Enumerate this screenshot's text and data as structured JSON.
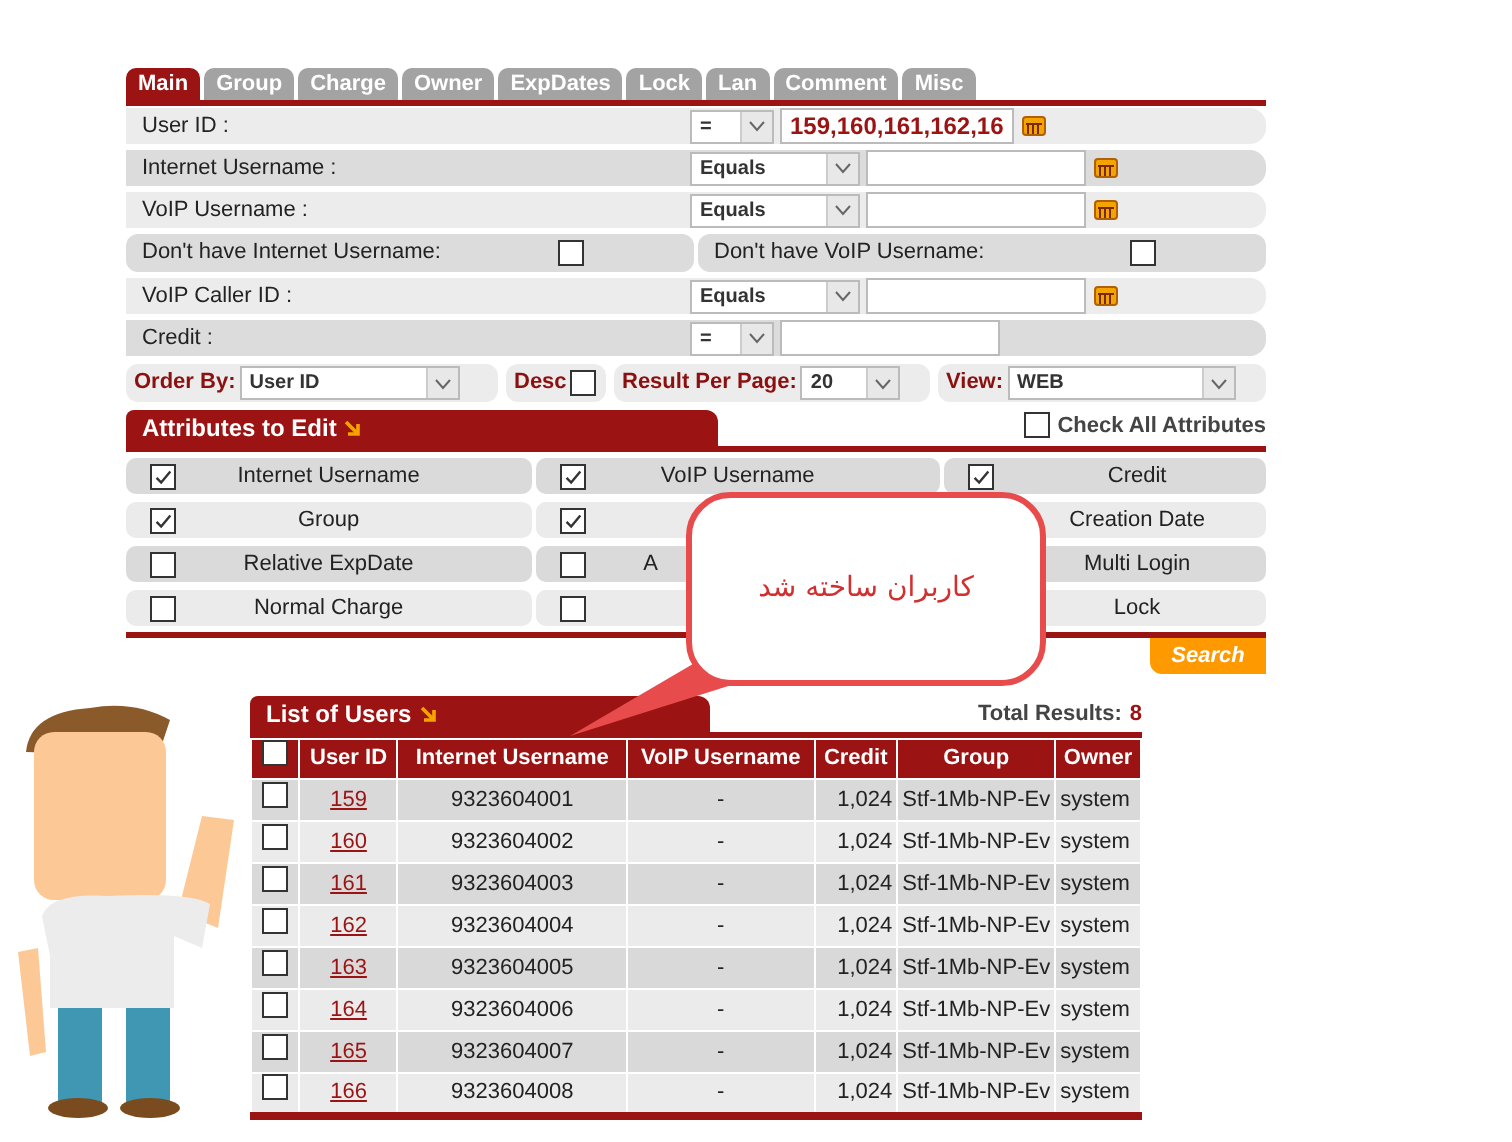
{
  "tabs": [
    {
      "label": "Main",
      "selected": true
    },
    {
      "label": "Group",
      "selected": false
    },
    {
      "label": "Charge",
      "selected": false
    },
    {
      "label": "Owner",
      "selected": false
    },
    {
      "label": "ExpDates",
      "selected": false
    },
    {
      "label": "Lock",
      "selected": false
    },
    {
      "label": "Lan",
      "selected": false
    },
    {
      "label": "Comment",
      "selected": false
    },
    {
      "label": "Misc",
      "selected": false
    }
  ],
  "filters": [
    {
      "kind": "text",
      "label": "User ID :",
      "operator": "=",
      "value": "159,160,161,162,16",
      "lookup_button": true
    },
    {
      "kind": "text",
      "label": "Internet Username :",
      "operator": "Equals",
      "lookup_button": true
    },
    {
      "kind": "text",
      "label": "VoIP Username :",
      "operator": "Equals",
      "lookup_button": true
    },
    {
      "kind": "checks",
      "items": [
        {
          "label": "Don't have Internet Username:",
          "checked": false
        },
        {
          "label": "Don't have VoIP Username:",
          "checked": false
        }
      ]
    },
    {
      "kind": "text",
      "label": "VoIP Caller ID :",
      "operator": "Equals",
      "lookup_button": true
    },
    {
      "kind": "text",
      "label": "Credit :",
      "operator": "=",
      "lookup_button": false
    }
  ],
  "options": {
    "order_by": {
      "label": "Order By:",
      "value": "User ID"
    },
    "desc": {
      "label": "Desc",
      "checked": false
    },
    "per_page": {
      "label": "Result Per Page:",
      "value": "20"
    },
    "view": {
      "label": "View:",
      "value": "WEB"
    }
  },
  "attributes": {
    "title": "Attributes to Edit",
    "check_all": {
      "label": "Check All Attributes",
      "checked": false
    },
    "rows": [
      [
        {
          "label": "Internet Username",
          "checked": true
        },
        {
          "label": "VoIP Username",
          "checked": true
        },
        {
          "label": "Credit",
          "checked": true
        }
      ],
      [
        {
          "label": "Group",
          "checked": true
        },
        {
          "checked": true
        },
        {
          "label": "Creation Date"
        }
      ],
      [
        {
          "label": "Relative ExpDate",
          "checked": false
        },
        {
          "label": "A",
          "checked": false,
          "partial": true
        },
        {
          "label": "Multi Login"
        }
      ],
      [
        {
          "label": "Normal Charge",
          "checked": false
        },
        {
          "checked": false
        },
        {
          "label": "Lock"
        }
      ]
    ]
  },
  "search_button": "Search",
  "users": {
    "title": "List of Users",
    "total_label": "Total Results:",
    "total": "8",
    "all_checked": false,
    "columns": [
      "User ID",
      "Internet Username",
      "VoIP Username",
      "Credit",
      "Group",
      "Owner"
    ],
    "rows": [
      {
        "selected": false,
        "cells": [
          "159",
          "9323604001",
          "-",
          "1,024",
          "Stf-1Mb-NP-Ev",
          "system"
        ]
      },
      {
        "selected": false,
        "cells": [
          "160",
          "9323604002",
          "-",
          "1,024",
          "Stf-1Mb-NP-Ev",
          "system"
        ]
      },
      {
        "selected": false,
        "cells": [
          "161",
          "9323604003",
          "-",
          "1,024",
          "Stf-1Mb-NP-Ev",
          "system"
        ]
      },
      {
        "selected": false,
        "cells": [
          "162",
          "9323604004",
          "-",
          "1,024",
          "Stf-1Mb-NP-Ev",
          "system"
        ]
      },
      {
        "selected": false,
        "cells": [
          "163",
          "9323604005",
          "-",
          "1,024",
          "Stf-1Mb-NP-Ev",
          "system"
        ]
      },
      {
        "selected": false,
        "cells": [
          "164",
          "9323604006",
          "-",
          "1,024",
          "Stf-1Mb-NP-Ev",
          "system"
        ]
      },
      {
        "selected": false,
        "cells": [
          "165",
          "9323604007",
          "-",
          "1,024",
          "Stf-1Mb-NP-Ev",
          "system"
        ]
      },
      {
        "selected": false,
        "cells": [
          "166",
          "9323604008",
          "-",
          "1,024",
          "Stf-1Mb-NP-Ev",
          "system"
        ]
      }
    ]
  },
  "callout": {
    "text": "کاربران ساخته شد"
  }
}
